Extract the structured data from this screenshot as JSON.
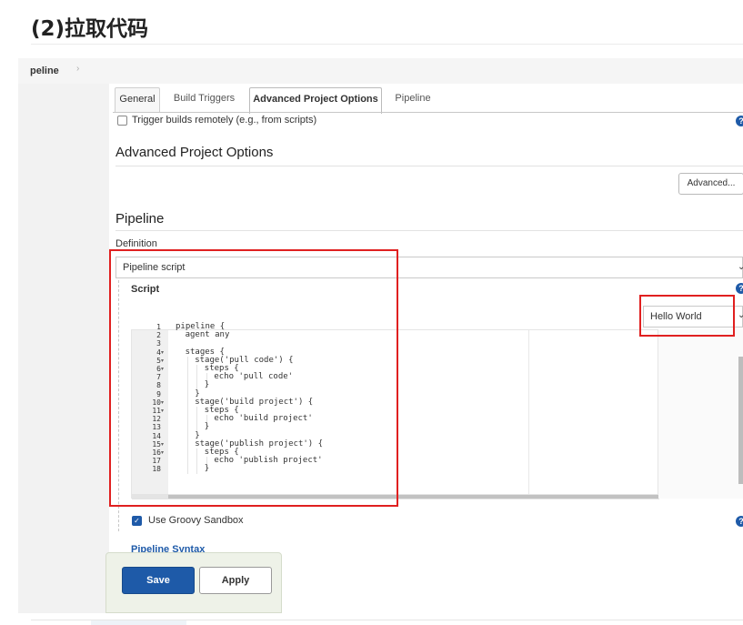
{
  "article": {
    "heading": "(2)拉取代码"
  },
  "breadcrumb": {
    "current": "peline",
    "arrow": "›"
  },
  "tabs": [
    {
      "label": "General",
      "active": false
    },
    {
      "label": "Build Triggers",
      "active": false
    },
    {
      "label": "Advanced Project Options",
      "active": true
    },
    {
      "label": "Pipeline",
      "active": false
    }
  ],
  "triggers": {
    "remote_label": "Trigger builds remotely (e.g., from scripts)",
    "remote_checked": false
  },
  "advanced_options": {
    "title": "Advanced Project Options",
    "advanced_button": "Advanced..."
  },
  "pipeline": {
    "title": "Pipeline",
    "definition_label": "Definition",
    "definition_value": "Pipeline script",
    "script_label": "Script",
    "template_select": "Hello World",
    "sandbox_label": "Use Groovy Sandbox",
    "sandbox_checked": true,
    "syntax_link": "Pipeline Syntax"
  },
  "editor": {
    "lines": [
      {
        "n": "1",
        "fold": "",
        "indent": 0,
        "text": "pipeline {"
      },
      {
        "n": "2",
        "fold": "",
        "indent": 1,
        "text": "agent any"
      },
      {
        "n": "3",
        "fold": "",
        "indent": 0,
        "text": ""
      },
      {
        "n": "4",
        "fold": "▾",
        "indent": 1,
        "text": "stages {"
      },
      {
        "n": "5",
        "fold": "▾",
        "indent": 2,
        "text": "stage('pull code') {"
      },
      {
        "n": "6",
        "fold": "▾",
        "indent": 3,
        "text": "steps {"
      },
      {
        "n": "7",
        "fold": "",
        "indent": 4,
        "text": "echo 'pull code'"
      },
      {
        "n": "8",
        "fold": "",
        "indent": 3,
        "text": "}"
      },
      {
        "n": "9",
        "fold": "",
        "indent": 2,
        "text": "}"
      },
      {
        "n": "10",
        "fold": "▾",
        "indent": 2,
        "text": "stage('build project') {"
      },
      {
        "n": "11",
        "fold": "▾",
        "indent": 3,
        "text": "steps {"
      },
      {
        "n": "12",
        "fold": "",
        "indent": 4,
        "text": "echo 'build project'"
      },
      {
        "n": "13",
        "fold": "",
        "indent": 3,
        "text": "}"
      },
      {
        "n": "14",
        "fold": "",
        "indent": 2,
        "text": "}"
      },
      {
        "n": "15",
        "fold": "▾",
        "indent": 2,
        "text": "stage('publish project') {"
      },
      {
        "n": "16",
        "fold": "▾",
        "indent": 3,
        "text": "steps {"
      },
      {
        "n": "17",
        "fold": "",
        "indent": 4,
        "text": "echo 'publish project'"
      },
      {
        "n": "18",
        "fold": "",
        "indent": 3,
        "text": "}"
      }
    ]
  },
  "actions": {
    "save": "Save",
    "apply": "Apply"
  },
  "colors": {
    "brand_blue": "#1e5aa8",
    "highlight_red": "#e02020"
  },
  "icons": {
    "help": "question-circle-icon",
    "dropdown": "chevron-down-icon"
  }
}
